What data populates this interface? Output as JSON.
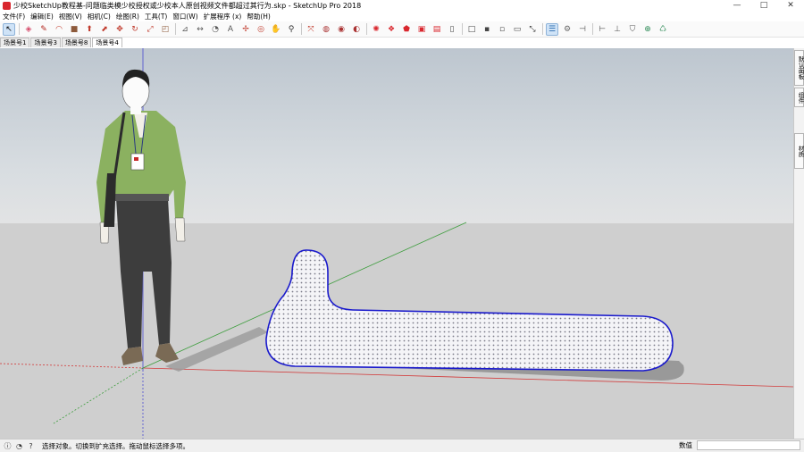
{
  "window": {
    "title": "少校SketchUp教程基-问题临类模少校授权或少校本人原创视频文件都超过其行为.skp - SketchUp Pro 2018",
    "controls": [
      "—",
      "□",
      "✕"
    ]
  },
  "menu": [
    "文件(F)",
    "编辑(E)",
    "视图(V)",
    "相机(C)",
    "绘图(R)",
    "工具(T)",
    "窗口(W)",
    "扩展程序 (x)",
    "帮助(H)"
  ],
  "toolbar": {
    "tools": [
      {
        "name": "select-icon",
        "glyph": "↖",
        "active": true
      },
      {
        "name": "eraser-icon",
        "glyph": "◈",
        "color": "#d64b6b"
      },
      {
        "name": "line-icon",
        "glyph": "✎",
        "color": "#b3261e"
      },
      {
        "name": "arc-icon",
        "glyph": "◠",
        "color": "#c0392b"
      },
      {
        "name": "shape-icon",
        "glyph": "■",
        "color": "#8d5a3b"
      },
      {
        "name": "push-pull-icon",
        "glyph": "⬆",
        "color": "#c0392b"
      },
      {
        "name": "follow-me-icon",
        "glyph": "⬈",
        "color": "#c0392b"
      },
      {
        "name": "move-icon",
        "glyph": "✥",
        "color": "#c0392b"
      },
      {
        "name": "rotate-icon",
        "glyph": "↻",
        "color": "#c0392b"
      },
      {
        "name": "scale-icon",
        "glyph": "⤢",
        "color": "#c0392b"
      },
      {
        "name": "offset-icon",
        "glyph": "◰",
        "color": "#8d5a3b"
      },
      {
        "name": "tape-measure-icon",
        "glyph": "⊿",
        "color": "#555555"
      },
      {
        "name": "dimension-icon",
        "glyph": "↔",
        "color": "#555555"
      },
      {
        "name": "protractor-icon",
        "glyph": "◔",
        "color": "#555555"
      },
      {
        "name": "text-icon",
        "glyph": "A",
        "color": "#555555"
      },
      {
        "name": "axes-icon",
        "glyph": "✢",
        "color": "#c0392b"
      },
      {
        "name": "orbit-icon",
        "glyph": "◎",
        "color": "#c0392b"
      },
      {
        "name": "pan-icon",
        "glyph": "✋",
        "color": "#c0392b"
      },
      {
        "name": "zoom-icon",
        "glyph": "⚲",
        "color": "#333333"
      },
      {
        "name": "zoom-extents-icon",
        "glyph": "⤧",
        "color": "#c0392b"
      },
      {
        "name": "warehouse-icon",
        "glyph": "◍",
        "color": "#a33"
      },
      {
        "name": "extension-warehouse-icon",
        "glyph": "◉",
        "color": "#a33"
      },
      {
        "name": "layout-icon",
        "glyph": "◐",
        "color": "#a33"
      },
      {
        "name": "gear-icon",
        "glyph": "✺",
        "color": "#d9272e"
      },
      {
        "name": "components-icon",
        "glyph": "❖",
        "color": "#d9272e"
      },
      {
        "name": "materials-icon",
        "glyph": "⬟",
        "color": "#d9272e"
      },
      {
        "name": "styles-icon",
        "glyph": "▣",
        "color": "#d9272e"
      },
      {
        "name": "shadows-icon",
        "glyph": "▤",
        "color": "#d9272e"
      },
      {
        "name": "iso-view-icon",
        "glyph": "▯",
        "color": "#444444"
      },
      {
        "name": "top-view-icon",
        "glyph": "□",
        "color": "#444444"
      },
      {
        "name": "front-view-icon",
        "glyph": "▪",
        "color": "#444444"
      },
      {
        "name": "right-view-icon",
        "glyph": "▫",
        "color": "#444444"
      },
      {
        "name": "back-view-icon",
        "glyph": "▭",
        "color": "#444444"
      },
      {
        "name": "expand-icon",
        "glyph": "⤡",
        "color": "#333333"
      },
      {
        "name": "outliner-icon",
        "glyph": "☰",
        "color": "#2b6cb0",
        "active": true
      },
      {
        "name": "settings-icon",
        "glyph": "⚙",
        "color": "#666666"
      },
      {
        "name": "section-plane-icon",
        "glyph": "⊣",
        "color": "#555555"
      },
      {
        "name": "section-cut-icon",
        "glyph": "⊢",
        "color": "#555555"
      },
      {
        "name": "section-fill-icon",
        "glyph": "⊥",
        "color": "#555555"
      },
      {
        "name": "shield-icon",
        "glyph": "⛉",
        "color": "#555555"
      },
      {
        "name": "add-location-icon",
        "glyph": "⊕",
        "color": "#2e8b57"
      },
      {
        "name": "recycle-icon",
        "glyph": "♺",
        "color": "#2e8b57"
      }
    ],
    "separators_after": [
      0,
      10,
      18,
      22,
      28,
      33,
      36
    ]
  },
  "scene_tabs": [
    {
      "label": "场景号1",
      "active": false
    },
    {
      "label": "场景号3",
      "active": false
    },
    {
      "label": "场景号8",
      "active": false
    },
    {
      "label": "场景号4",
      "active": true
    }
  ],
  "right_tray": [
    "默认面板",
    "组件",
    "材质"
  ],
  "status": {
    "icons": [
      "info-icon",
      "user-icon",
      "help-icon"
    ],
    "message": "选择对象。切换到扩充选择。拖动鼠标选择多项。",
    "measurements_label": "数值",
    "measurements_value": ""
  },
  "colors": {
    "sky": "#c4ccd4",
    "ground": "#cfcfcf",
    "selection": "#1a1acc",
    "axis_red": "#d23a3a",
    "axis_green": "#3c9d3c",
    "axis_blue": "#4a4ad0",
    "brand": "#d9272e"
  }
}
